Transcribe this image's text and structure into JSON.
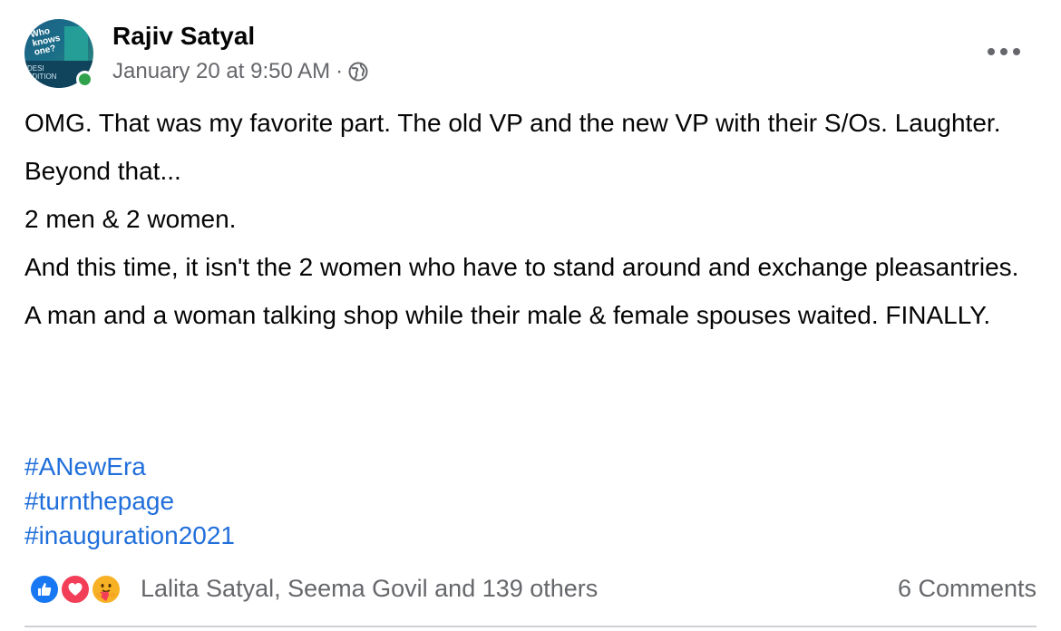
{
  "post": {
    "author": "Rajiv Satyal",
    "timestamp": "January 20 at 9:50 AM",
    "separator": "·",
    "privacy_icon": "globe-icon",
    "avatar": {
      "text": "Who knows one?",
      "footer_text": "DESI EDITION"
    },
    "more_icon": "more-horizontal-icon",
    "paragraphs": [
      "OMG. That was my favorite part. The old VP and the new VP with their S/Os. Laughter.",
      "Beyond that...",
      "2 men & 2 women.",
      "And this time, it isn't the 2 women who have to stand around and exchange pleasantries.",
      "A man and a woman talking shop while their male & female spouses waited. FINALLY."
    ],
    "hashtags": [
      "#ANewEra",
      "#turnthepage",
      "#inauguration2021"
    ]
  },
  "footer": {
    "reactions": [
      "like-icon",
      "love-icon",
      "care-icon"
    ],
    "reaction_summary": "Lalita Satyal, Seema Govil and 139 others",
    "comments": "6 Comments"
  },
  "colors": {
    "link": "#216fdb",
    "secondary_text": "#65676b",
    "online": "#31a24c",
    "like": "#1877f2",
    "love": "#f33e58",
    "care": "#f7b125"
  }
}
